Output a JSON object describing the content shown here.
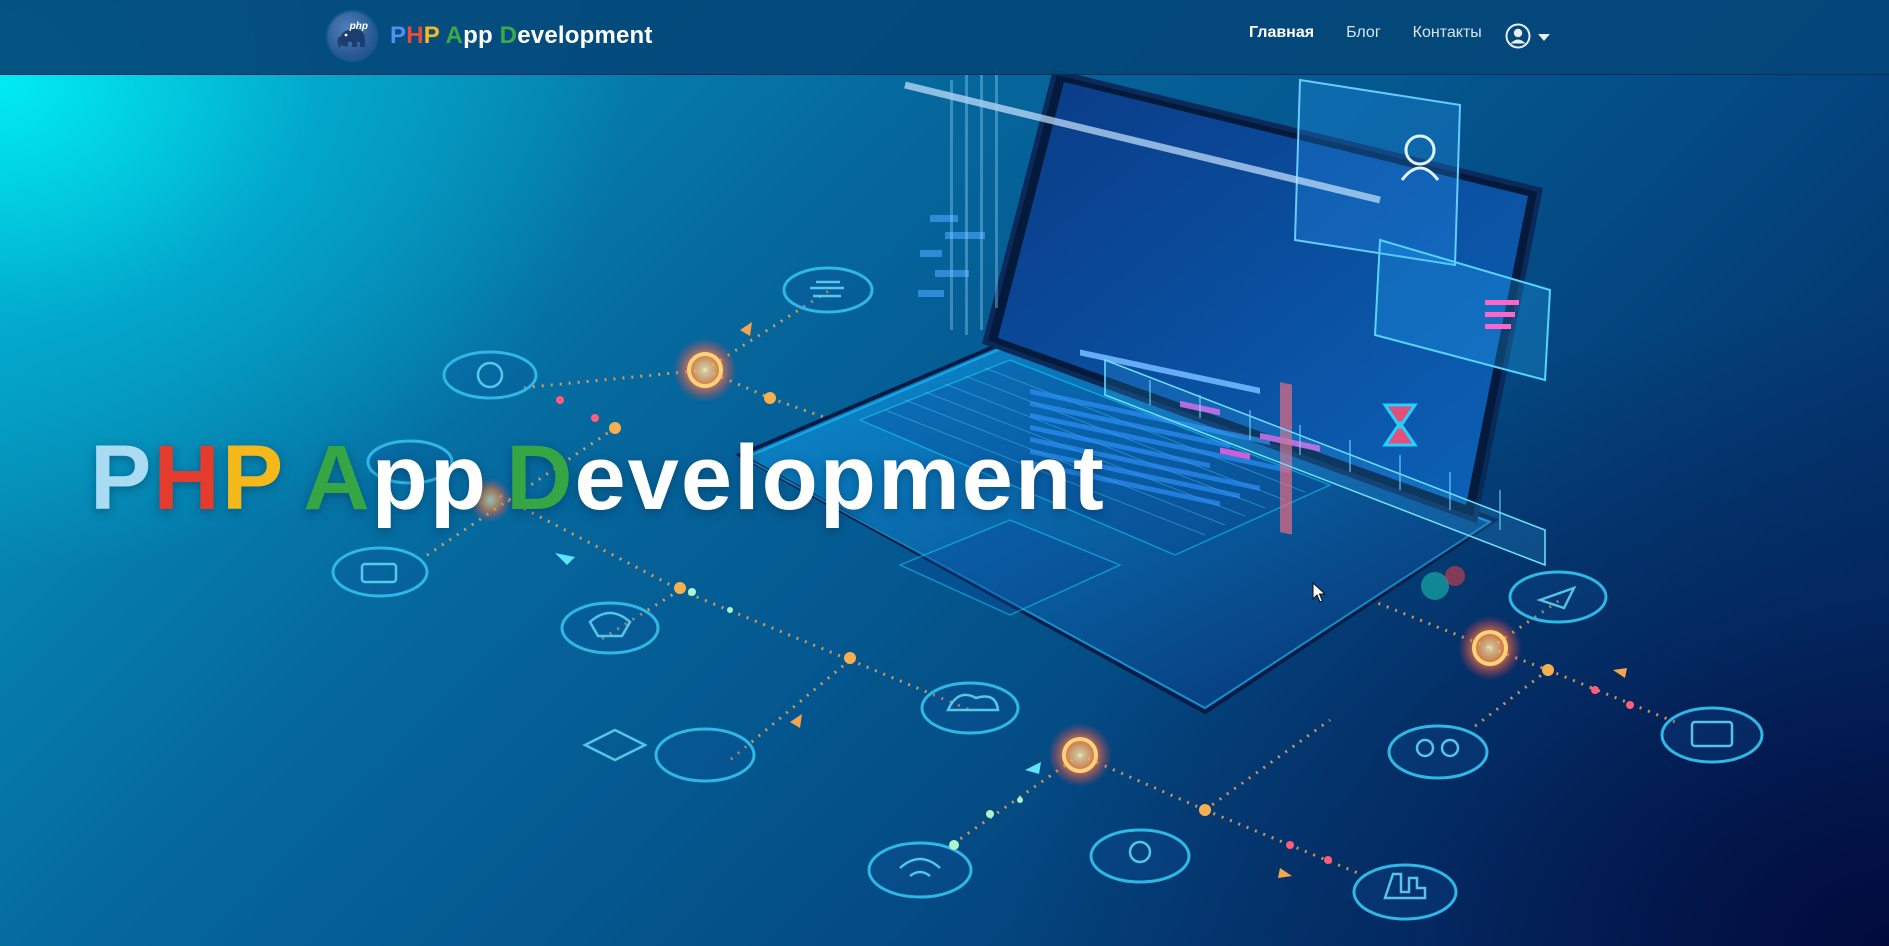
{
  "brand": {
    "php_badge": "php",
    "title_parts": [
      {
        "text": "P",
        "color": "blue"
      },
      {
        "text": "H",
        "color": "red"
      },
      {
        "text": "P",
        "color": "yellow"
      },
      {
        "text": " ",
        "color": "white"
      },
      {
        "text": "A",
        "color": "green"
      },
      {
        "text": "pp ",
        "color": "white"
      },
      {
        "text": "D",
        "color": "green"
      },
      {
        "text": "evelopment",
        "color": "white"
      }
    ]
  },
  "nav": {
    "items": [
      {
        "label": "Главная",
        "active": true
      },
      {
        "label": "Блог",
        "active": false
      },
      {
        "label": "Контакты",
        "active": false
      }
    ],
    "user_icon": "user-circle-icon",
    "dropdown_icon": "caret-down-icon"
  },
  "hero": {
    "headline_parts": [
      {
        "text": "P",
        "color": "blue"
      },
      {
        "text": "H",
        "color": "red"
      },
      {
        "text": "P",
        "color": "yellow"
      },
      {
        "text": "A",
        "color": "green"
      },
      {
        "text": "pp",
        "color": "white"
      },
      {
        "text": "D",
        "color": "green"
      },
      {
        "text": "evelopment",
        "color": "white"
      }
    ],
    "background_image": "isometric-laptop-network-illustration"
  },
  "colors": {
    "navbar_bg": "#04467a",
    "brand_blue": "#4f8ff2",
    "brand_red": "#e94a3a",
    "brand_yellow": "#f5b921",
    "brand_green": "#3ca94b",
    "accent_cyan": "#00e6f0"
  }
}
